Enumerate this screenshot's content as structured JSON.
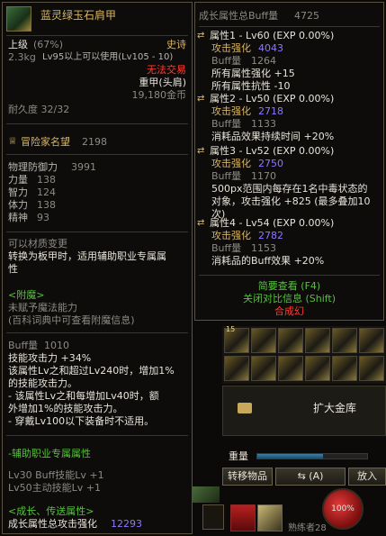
{
  "item": {
    "name": "蓝灵绿玉石肩甲",
    "grade": "上级",
    "grade_pct": "(67%)",
    "rarity": "史诗",
    "weight": "2.3kg",
    "level_req": "Lv95以上可以使用(Lv105 - 10)",
    "trade": "无法交易",
    "slot": "重甲(头肩)",
    "price": "19,180金币",
    "durability": "耐久度 32/32",
    "fame": "冒险家名望",
    "fame_val": "2198",
    "stats": [
      {
        "label": "物理防御力",
        "value": "3991"
      },
      {
        "label": "力量",
        "value": "138"
      },
      {
        "label": "智力",
        "value": "124"
      },
      {
        "label": "体力",
        "value": "138"
      },
      {
        "label": "精神",
        "value": "93"
      }
    ],
    "transform": [
      "可以材质变更",
      "转换为板甲时，适用辅助职业专属属",
      "性"
    ],
    "enchant_title": "<附魔>",
    "enchant_1": "未赋予魔法能力",
    "enchant_2": "(百科词典中可查看附魔信息)",
    "buff_label": "Buff量",
    "buff_val": "1010",
    "buff_lines": [
      "技能攻击力 +34%",
      "该属性Lv之和超过Lv240时，增加1%",
      "的技能攻击力。",
      "- 该属性Lv之和每增加Lv40时，额",
      "外增加1%的技能攻击力。",
      "- 穿戴Lv100以下装备时不适用。"
    ],
    "support_title": "-辅助职业专属属性",
    "support_1": "Lv30 Buff技能Lv +1",
    "support_2": "Lv50主动技能Lv +1",
    "growth_title": "<成长、传送属性>",
    "growth_label": "成长属性总攻击强化",
    "growth_val": "12293"
  },
  "tooltip": {
    "header": "成长属性总Buff量",
    "header_val": "4725",
    "groups": [
      {
        "title": "属性1 - Lv60 (EXP 0.00%)",
        "atk_label": "攻击强化",
        "atk": "4043",
        "buff_label": "Buff量",
        "buff": "1264",
        "lines": [
          "所有属性强化 +15",
          "所有属性抗性 -10"
        ]
      },
      {
        "title": "属性2 - Lv50 (EXP 0.00%)",
        "atk_label": "攻击强化",
        "atk": "2718",
        "buff_label": "Buff量",
        "buff": "1133",
        "lines": [
          "消耗品效果持续时间 +20%"
        ]
      },
      {
        "title": "属性3 - Lv52 (EXP 0.00%)",
        "atk_label": "攻击强化",
        "atk": "2750",
        "buff_label": "Buff量",
        "buff": "1170",
        "lines": [
          "500px范围内每存在1名中毒状态的",
          "对象，攻击强化 +825 (最多叠加10",
          "次)"
        ]
      },
      {
        "title": "属性4 - Lv54 (EXP 0.00%)",
        "atk_label": "攻击强化",
        "atk": "2782",
        "buff_label": "Buff量",
        "buff": "1153",
        "lines": [
          "消耗品的Buff效果 +20%"
        ]
      }
    ],
    "brief": "简要查看 (F4)",
    "compare": "关闭对比信息 (Shift)",
    "craft": "合成幻"
  },
  "inventory": {
    "expand": "扩大金库",
    "weight": "重量",
    "transfer": "转移物品",
    "auto": "(A)",
    "put": "放入",
    "hp": "100%",
    "badge": "15",
    "proficiency": "熟练者28"
  },
  "colors": {
    "gold": "#d7b563",
    "blue": "#8c78ff",
    "red": "#ff3b30",
    "green": "#55c23a"
  }
}
